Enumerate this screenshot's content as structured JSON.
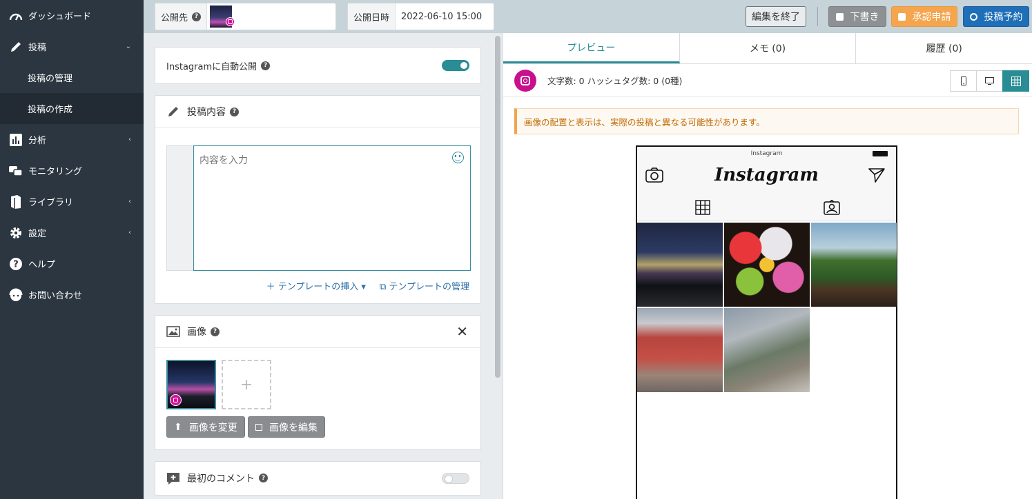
{
  "sidebar": {
    "items": [
      {
        "label": "ダッシュボード",
        "icon": "dashboard-gauge-icon"
      },
      {
        "label": "投稿",
        "icon": "pencil-icon",
        "chevron": "⌄"
      },
      {
        "label": "分析",
        "icon": "bar-chart-icon",
        "chevron": "‹"
      },
      {
        "label": "モニタリング",
        "icon": "chat-bubbles-icon"
      },
      {
        "label": "ライブラリ",
        "icon": "book-icon",
        "chevron": "‹"
      },
      {
        "label": "設定",
        "icon": "gear-icon",
        "chevron": "‹"
      },
      {
        "label": "ヘルプ",
        "icon": "question-icon"
      },
      {
        "label": "お問い合わせ",
        "icon": "support-icon"
      }
    ],
    "subitems": [
      {
        "label": "投稿の管理"
      },
      {
        "label": "投稿の作成"
      }
    ]
  },
  "topbar": {
    "publish_to_label": "公開先",
    "publish_time_label": "公開日時",
    "publish_time_value": "2022-06-10 15:00",
    "end_edit": "編集を終了",
    "draft": "下書き",
    "approval": "承認申請",
    "schedule": "投稿予約"
  },
  "editor": {
    "auto_publish_label": "Instagramに自動公開",
    "content_title": "投稿内容",
    "content_placeholder": "内容を入力",
    "insert_template": "＋ テンプレートの挿入 ▾",
    "manage_template": "⧉ テンプレートの管理",
    "image_title": "画像",
    "change_image": "画像を変更",
    "edit_image": "画像を編集",
    "first_comment_title": "最初のコメント"
  },
  "preview": {
    "tabs": [
      "プレビュー",
      "メモ (0)",
      "履歴 (0)"
    ],
    "stats": "文字数: 0 ハッシュタグ数: 0 (0種)",
    "notice": "画像の配置と表示は、実際の投稿と異なる可能性があります。",
    "phone_status": "Instagram",
    "logo": "Instagram"
  },
  "colors": {
    "sidebar_bg": "#2b3640",
    "accent": "#2a8c95",
    "instagram": "#c8108f",
    "orange": "#f5a54d",
    "blue": "#1f6fb8"
  }
}
